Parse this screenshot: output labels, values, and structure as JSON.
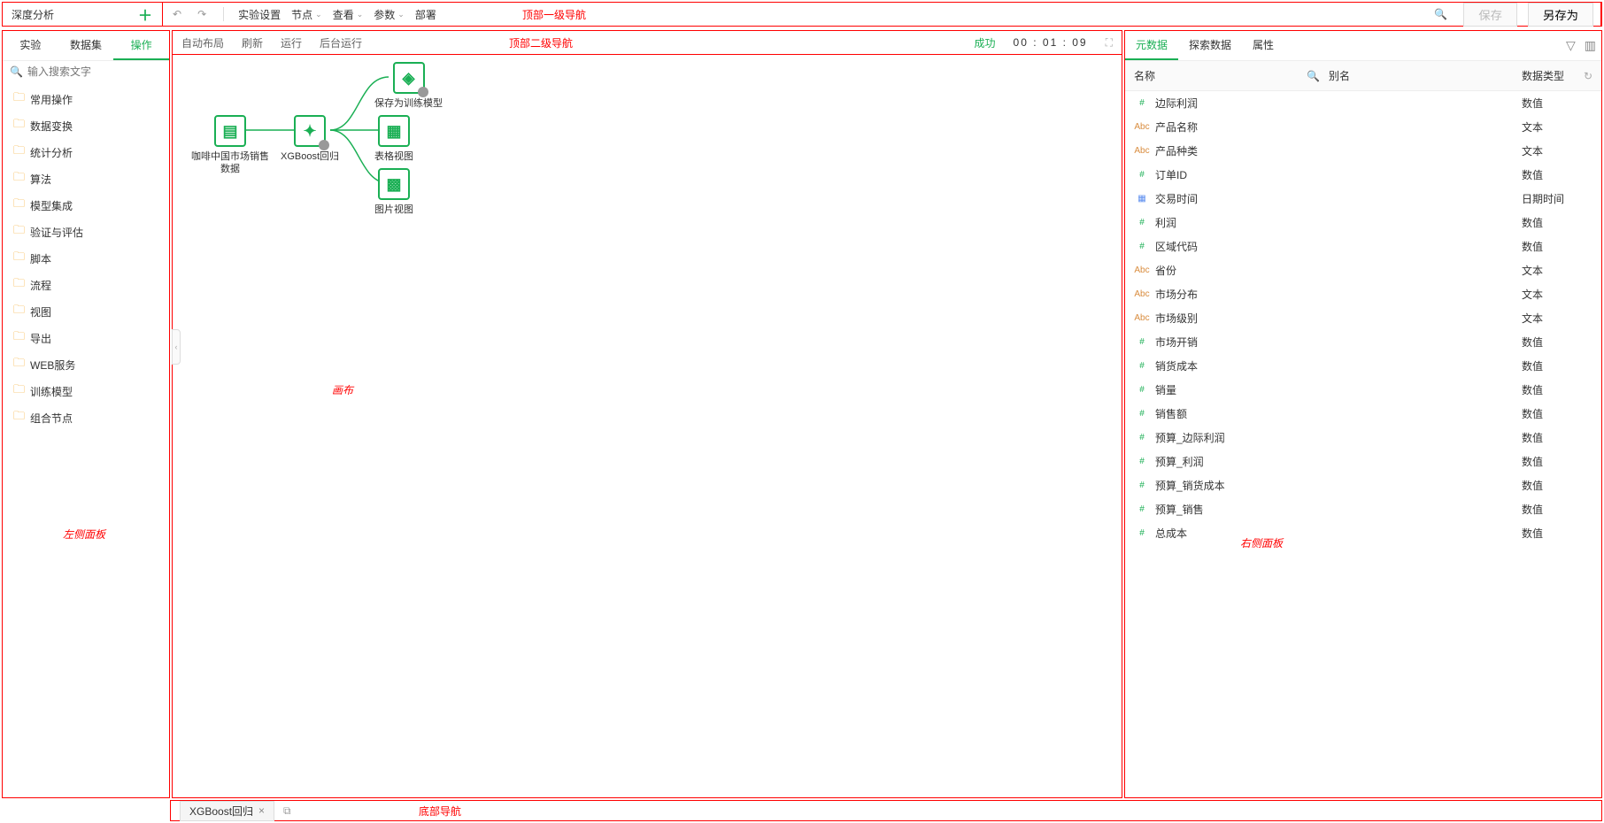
{
  "app": {
    "title": "深度分析"
  },
  "topnav1": {
    "experiment_settings": "实验设置",
    "node": "节点",
    "view": "查看",
    "params": "参数",
    "deploy": "部署",
    "save": "保存",
    "save_as": "另存为",
    "annotation": "顶部一级导航"
  },
  "left": {
    "tabs": [
      "实验",
      "数据集",
      "操作"
    ],
    "active_tab_index": 2,
    "search_placeholder": "输入搜索文字",
    "folders": [
      "常用操作",
      "数据变换",
      "统计分析",
      "算法",
      "模型集成",
      "验证与评估",
      "脚本",
      "流程",
      "视图",
      "导出",
      "WEB服务",
      "训练模型",
      "组合节点"
    ],
    "annotation": "左侧面板"
  },
  "topnav2": {
    "auto_layout": "自动布局",
    "refresh": "刷新",
    "run": "运行",
    "run_bg": "后台运行",
    "status": "成功",
    "time": "00 : 01 : 09",
    "annotation": "顶部二级导航"
  },
  "canvas": {
    "annotation": "画布",
    "nodes": {
      "n1": "咖啡中国市场销售数据",
      "n2": "XGBoost回归",
      "n3": "保存为训练模型",
      "n4": "表格视图",
      "n5": "图片视图"
    }
  },
  "right": {
    "tabs": [
      "元数据",
      "探索数据",
      "属性"
    ],
    "active_tab_index": 0,
    "headers": {
      "name": "名称",
      "alias": "别名",
      "dtype": "数据类型"
    },
    "rows": [
      {
        "icon": "#",
        "kind": "num",
        "name": "边际利润",
        "dtype": "数值"
      },
      {
        "icon": "Abc",
        "kind": "txt",
        "name": "产品名称",
        "dtype": "文本"
      },
      {
        "icon": "Abc",
        "kind": "txt",
        "name": "产品种类",
        "dtype": "文本"
      },
      {
        "icon": "#",
        "kind": "num",
        "name": "订单ID",
        "dtype": "数值"
      },
      {
        "icon": "▦",
        "kind": "date",
        "name": "交易时间",
        "dtype": "日期时间"
      },
      {
        "icon": "#",
        "kind": "num",
        "name": "利润",
        "dtype": "数值"
      },
      {
        "icon": "#",
        "kind": "num",
        "name": "区域代码",
        "dtype": "数值"
      },
      {
        "icon": "Abc",
        "kind": "txt",
        "name": "省份",
        "dtype": "文本"
      },
      {
        "icon": "Abc",
        "kind": "txt",
        "name": "市场分布",
        "dtype": "文本"
      },
      {
        "icon": "Abc",
        "kind": "txt",
        "name": "市场级别",
        "dtype": "文本"
      },
      {
        "icon": "#",
        "kind": "num",
        "name": "市场开销",
        "dtype": "数值"
      },
      {
        "icon": "#",
        "kind": "num",
        "name": "销货成本",
        "dtype": "数值"
      },
      {
        "icon": "#",
        "kind": "num",
        "name": "销量",
        "dtype": "数值"
      },
      {
        "icon": "#",
        "kind": "num",
        "name": "销售额",
        "dtype": "数值"
      },
      {
        "icon": "#",
        "kind": "num",
        "name": "预算_边际利润",
        "dtype": "数值"
      },
      {
        "icon": "#",
        "kind": "num",
        "name": "预算_利润",
        "dtype": "数值"
      },
      {
        "icon": "#",
        "kind": "num",
        "name": "预算_销货成本",
        "dtype": "数值"
      },
      {
        "icon": "#",
        "kind": "num",
        "name": "预算_销售",
        "dtype": "数值"
      },
      {
        "icon": "#",
        "kind": "num",
        "name": "总成本",
        "dtype": "数值"
      }
    ],
    "annotation": "右侧面板"
  },
  "bottom": {
    "tab_label": "XGBoost回归",
    "annotation": "底部导航"
  }
}
